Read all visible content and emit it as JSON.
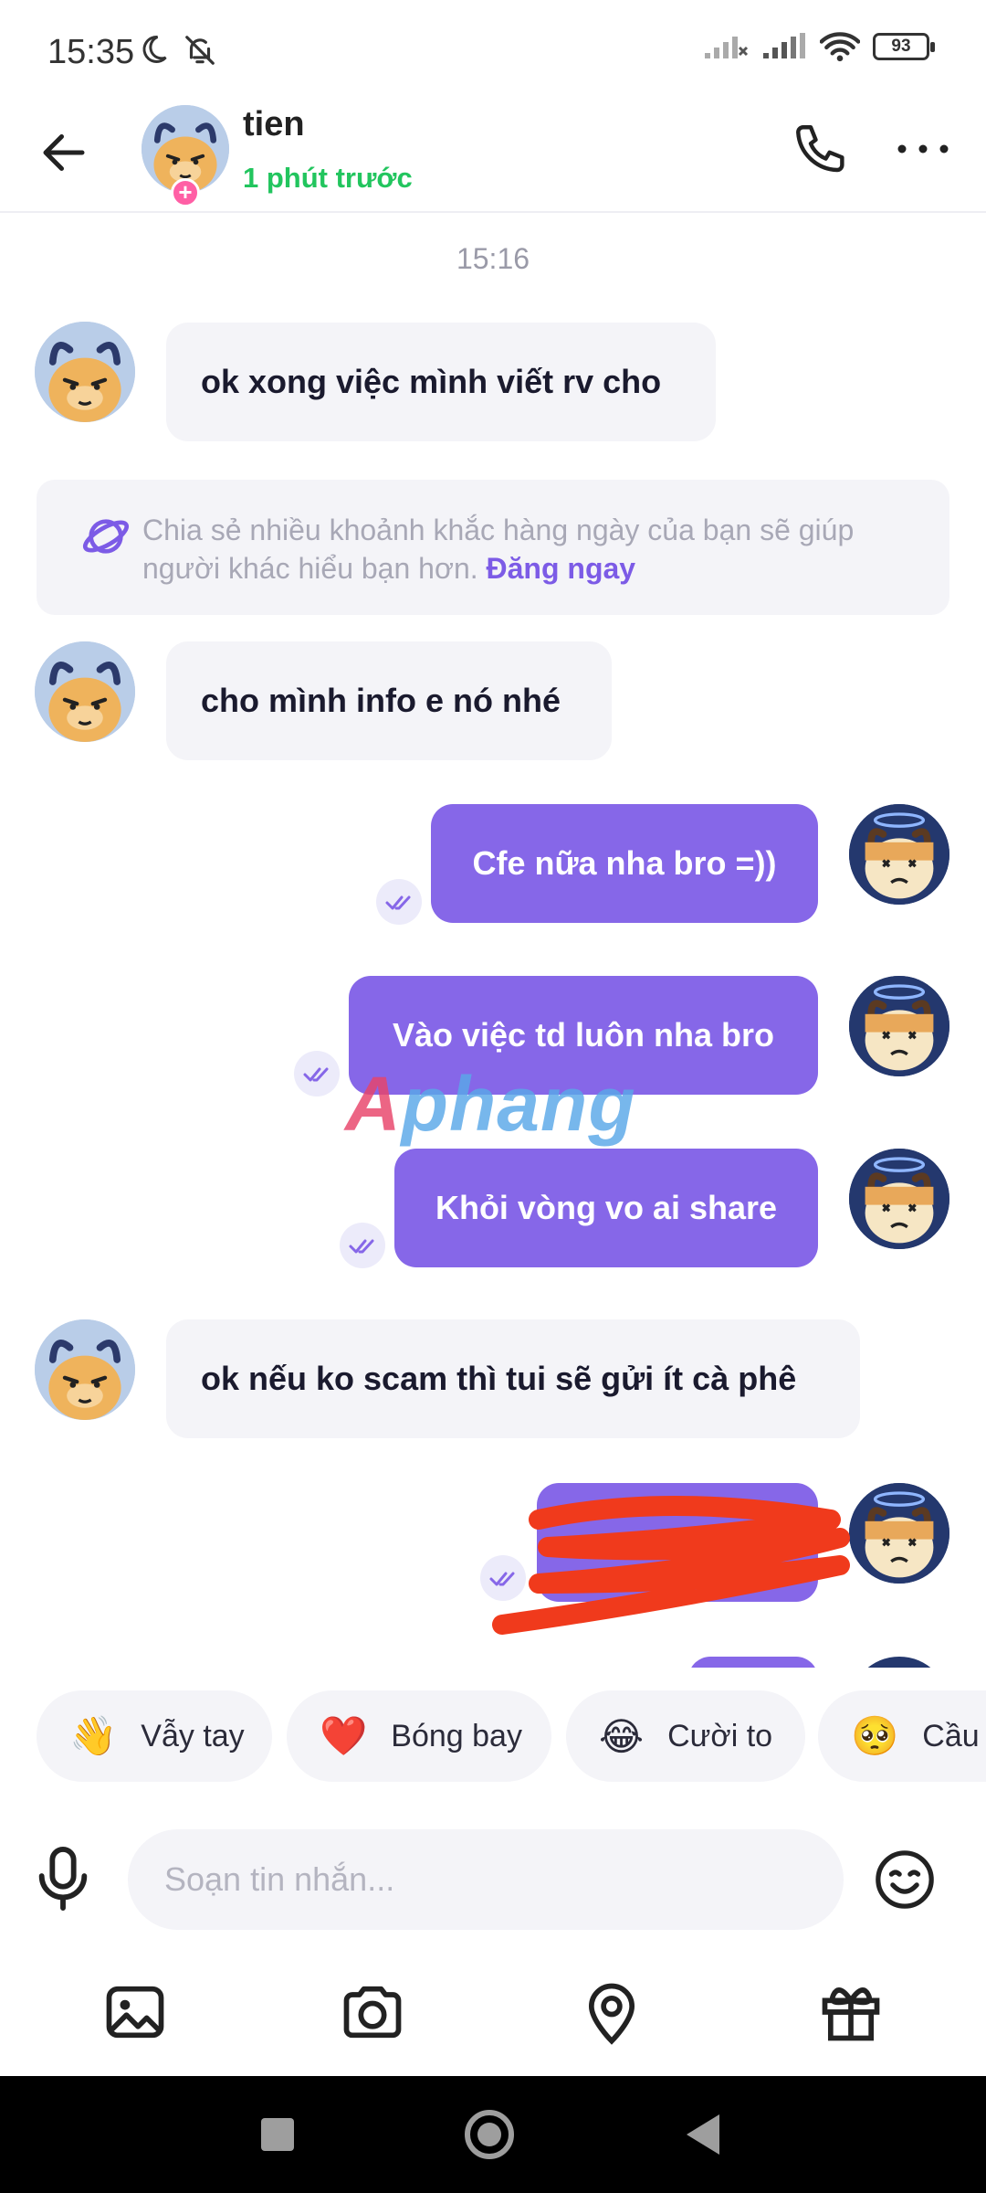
{
  "status_bar": {
    "time": "15:35",
    "battery": "93"
  },
  "header": {
    "name": "tien",
    "status": "1 phút trước"
  },
  "chat": {
    "time_separator": "15:16",
    "messages": [
      {
        "from": "other",
        "text": "ok xong việc mình viết rv cho"
      },
      {
        "from": "other",
        "text": "cho mình info e nó nhé"
      },
      {
        "from": "me",
        "text": "Cfe nữa nha bro =))"
      },
      {
        "from": "me",
        "text": "Vào việc td luôn nha bro"
      },
      {
        "from": "me",
        "text": "Khỏi vòng vo ai share"
      },
      {
        "from": "other",
        "text": "ok nếu ko scam thì tui sẽ gửi ít cà phê"
      }
    ],
    "prompt": {
      "text": "Chia sẻ nhiều khoảnh khắc hàng ngày của bạn sẽ giúp người khác hiểu bạn hơn.",
      "link": "Đăng ngay"
    },
    "watermark": {
      "prefix": "A",
      "rest": "phang"
    }
  },
  "quick_reactions": [
    {
      "emoji": "👋",
      "label": "Vẫy tay"
    },
    {
      "emoji": "❤️",
      "label": "Bóng bay"
    },
    {
      "emoji": "😂",
      "label": "Cười to"
    },
    {
      "emoji": "🥺",
      "label": "Cầu x"
    }
  ],
  "input": {
    "placeholder": "Soạn tin nhắn..."
  },
  "colors": {
    "accent": "#8667e8",
    "online": "#22c55e",
    "bubble_in": "#f4f4f8",
    "redaction": "#f03a1c"
  }
}
